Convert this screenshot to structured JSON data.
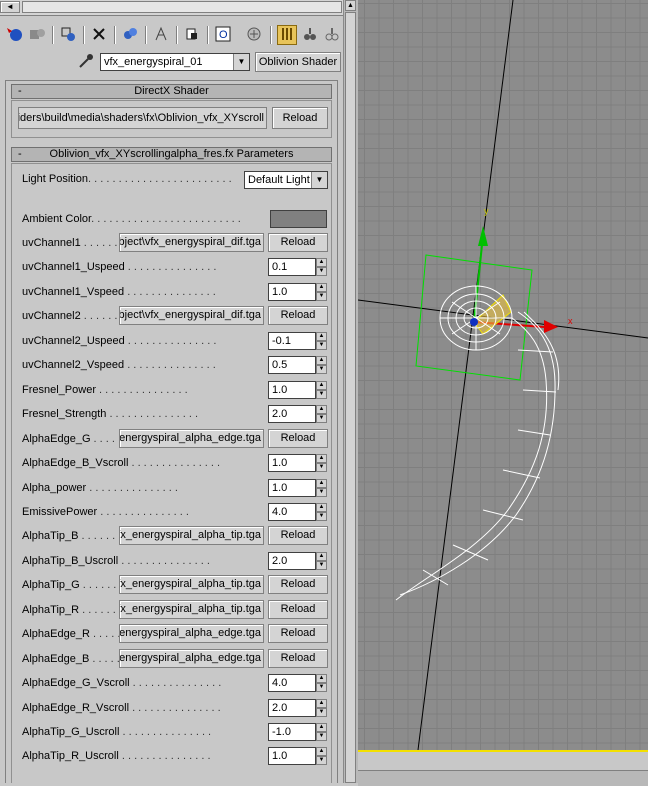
{
  "material_selector": {
    "name": "vfx_energyspiral_01",
    "type_button": "Oblivion Shader"
  },
  "directx_rollout": {
    "title": "DirectX Shader",
    "shader_path": "iders\\build\\media\\shaders\\fx\\Oblivion_vfx_XYscroll",
    "reload_label": "Reload"
  },
  "params_rollout": {
    "title": "Oblivion_vfx_XYscrollingalpha_fres.fx Parameters",
    "light_position_label": "Light Position",
    "light_position_value": "Default Light",
    "ambient_label": "Ambient Color",
    "ambient_color": "#808080",
    "reload_label": "Reload",
    "rows": [
      {
        "label": "uvChannel1",
        "type": "map",
        "value": "bject\\vfx_energyspiral_dif.tga"
      },
      {
        "label": "uvChannel1_Uspeed",
        "type": "spin",
        "value": "0.1"
      },
      {
        "label": "uvChannel1_Vspeed",
        "type": "spin",
        "value": "1.0"
      },
      {
        "label": "uvChannel2",
        "type": "map",
        "value": "bject\\vfx_energyspiral_dif.tga"
      },
      {
        "label": "uvChannel2_Uspeed",
        "type": "spin",
        "value": "-0.1"
      },
      {
        "label": "uvChannel2_Vspeed",
        "type": "spin",
        "value": "0.5"
      },
      {
        "label": "Fresnel_Power",
        "type": "spin",
        "value": "1.0"
      },
      {
        "label": "Fresnel_Strength",
        "type": "spin",
        "value": "2.0"
      },
      {
        "label": "AlphaEdge_G",
        "type": "map",
        "value": "energyspiral_alpha_edge.tga"
      },
      {
        "label": "AlphaEdge_B_Vscroll",
        "type": "spin",
        "value": "1.0"
      },
      {
        "label": "Alpha_power",
        "type": "spin",
        "value": "1.0"
      },
      {
        "label": "EmissivePower",
        "type": "spin",
        "value": "4.0"
      },
      {
        "label": "AlphaTip_B",
        "type": "map",
        "value": "fx_energyspiral_alpha_tip.tga"
      },
      {
        "label": "AlphaTip_B_Uscroll",
        "type": "spin",
        "value": "2.0"
      },
      {
        "label": "AlphaTip_G",
        "type": "map",
        "value": "fx_energyspiral_alpha_tip.tga"
      },
      {
        "label": "AlphaTip_R",
        "type": "map",
        "value": "fx_energyspiral_alpha_tip.tga"
      },
      {
        "label": "AlphaEdge_R",
        "type": "map",
        "value": "energyspiral_alpha_edge.tga"
      },
      {
        "label": "AlphaEdge_B",
        "type": "map",
        "value": "energyspiral_alpha_edge.tga"
      },
      {
        "label": "AlphaEdge_G_Vscroll",
        "type": "spin",
        "value": "4.0"
      },
      {
        "label": "AlphaEdge_R_Vscroll",
        "type": "spin",
        "value": "2.0"
      },
      {
        "label": "AlphaTip_G_Uscroll",
        "type": "spin",
        "value": "-1.0"
      },
      {
        "label": "AlphaTip_R_Uscroll",
        "type": "spin",
        "value": "1.0"
      }
    ]
  },
  "viewport": {
    "axis_x_label": "x",
    "axis_y_label": "y",
    "grid_color": "#7f7f7f",
    "background_color": "#8c8c8c",
    "selection_color": "#00ff00",
    "x_axis_color": "#ff0000",
    "y_axis_color": "#00c000",
    "active_border_color": "#f3e000"
  },
  "toolbar_icons": [
    "put-to-scene-icon",
    "assign-material-icon",
    "reset-map-icon",
    "delete-icon",
    "make-unique-icon",
    "put-to-library-icon",
    "material-id-icon",
    "show-map-icon",
    "show-end-result-icon",
    "go-to-parent-icon",
    "go-forward-icon",
    "material-navigator-icon"
  ]
}
